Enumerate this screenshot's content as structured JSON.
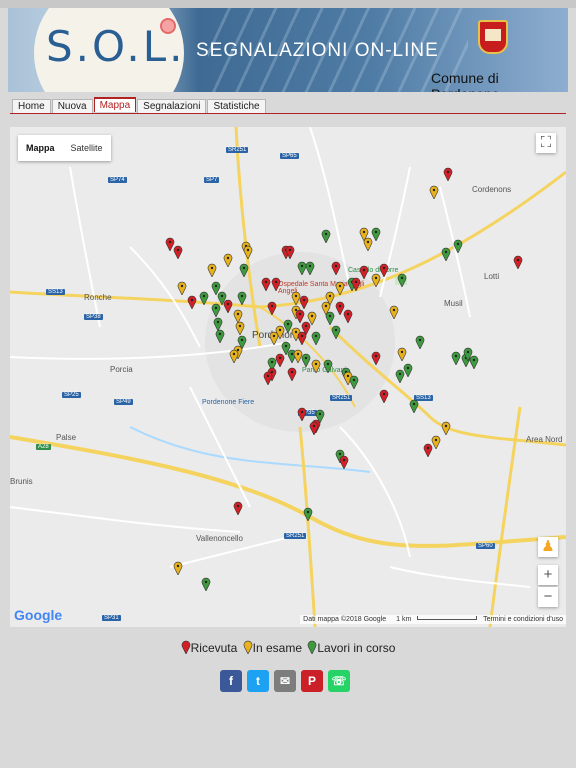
{
  "header": {
    "logo_text": "S.O.L.",
    "title": "SEGNALAZIONI ON-LINE",
    "comune": "Comune di Pordenone"
  },
  "tabs": [
    {
      "label": "Home",
      "active": false
    },
    {
      "label": "Nuova",
      "active": false
    },
    {
      "label": "Mappa",
      "active": true
    },
    {
      "label": "Segnalazioni",
      "active": false
    },
    {
      "label": "Statistiche",
      "active": false
    }
  ],
  "map": {
    "type_buttons": {
      "map": "Mappa",
      "satellite": "Satellite"
    },
    "fullscreen_icon": "fullscreen-icon",
    "pegman_icon": "pegman-icon",
    "zoom_in": "+",
    "zoom_out": "−",
    "attribution": {
      "data": "Dati mappa ©2018 Google",
      "scale": "1 km",
      "terms": "Termini e condizioni d'uso"
    },
    "google_logo": "Google",
    "place_labels": [
      "Cordenons",
      "Lotti",
      "Ronche",
      "Musil",
      "Porcia",
      "Palse",
      "Area Nord",
      "Brunis",
      "Vallenoncello",
      "Pordenone",
      "Castello di Torre",
      "Ospedale Santa Maria degli Angeli",
      "Parco Galvani",
      "Pordenone Fiere"
    ],
    "road_labels": [
      "SR251",
      "SP65",
      "SP7",
      "SP74",
      "SS13",
      "SP38",
      "SP25",
      "SP49",
      "A28",
      "SS13",
      "SP35",
      "SR251",
      "SP60",
      "SP31",
      "SR251"
    ],
    "status_colors": {
      "ricevuta": "#d32027",
      "in_esame": "#e7b21d",
      "lavori": "#3f9a3f"
    }
  },
  "legend": {
    "ricevuta": "Ricevuta",
    "in_esame": "In esame",
    "lavori": "Lavori in corso"
  },
  "social": [
    {
      "name": "facebook",
      "glyph": "f",
      "color": "#3b5998"
    },
    {
      "name": "twitter",
      "glyph": "t",
      "color": "#1da1f2"
    },
    {
      "name": "email",
      "glyph": "✉",
      "color": "#7d7d7d"
    },
    {
      "name": "pinterest",
      "glyph": "P",
      "color": "#cb2027"
    },
    {
      "name": "whatsapp",
      "glyph": "☏",
      "color": "#25d366"
    }
  ]
}
